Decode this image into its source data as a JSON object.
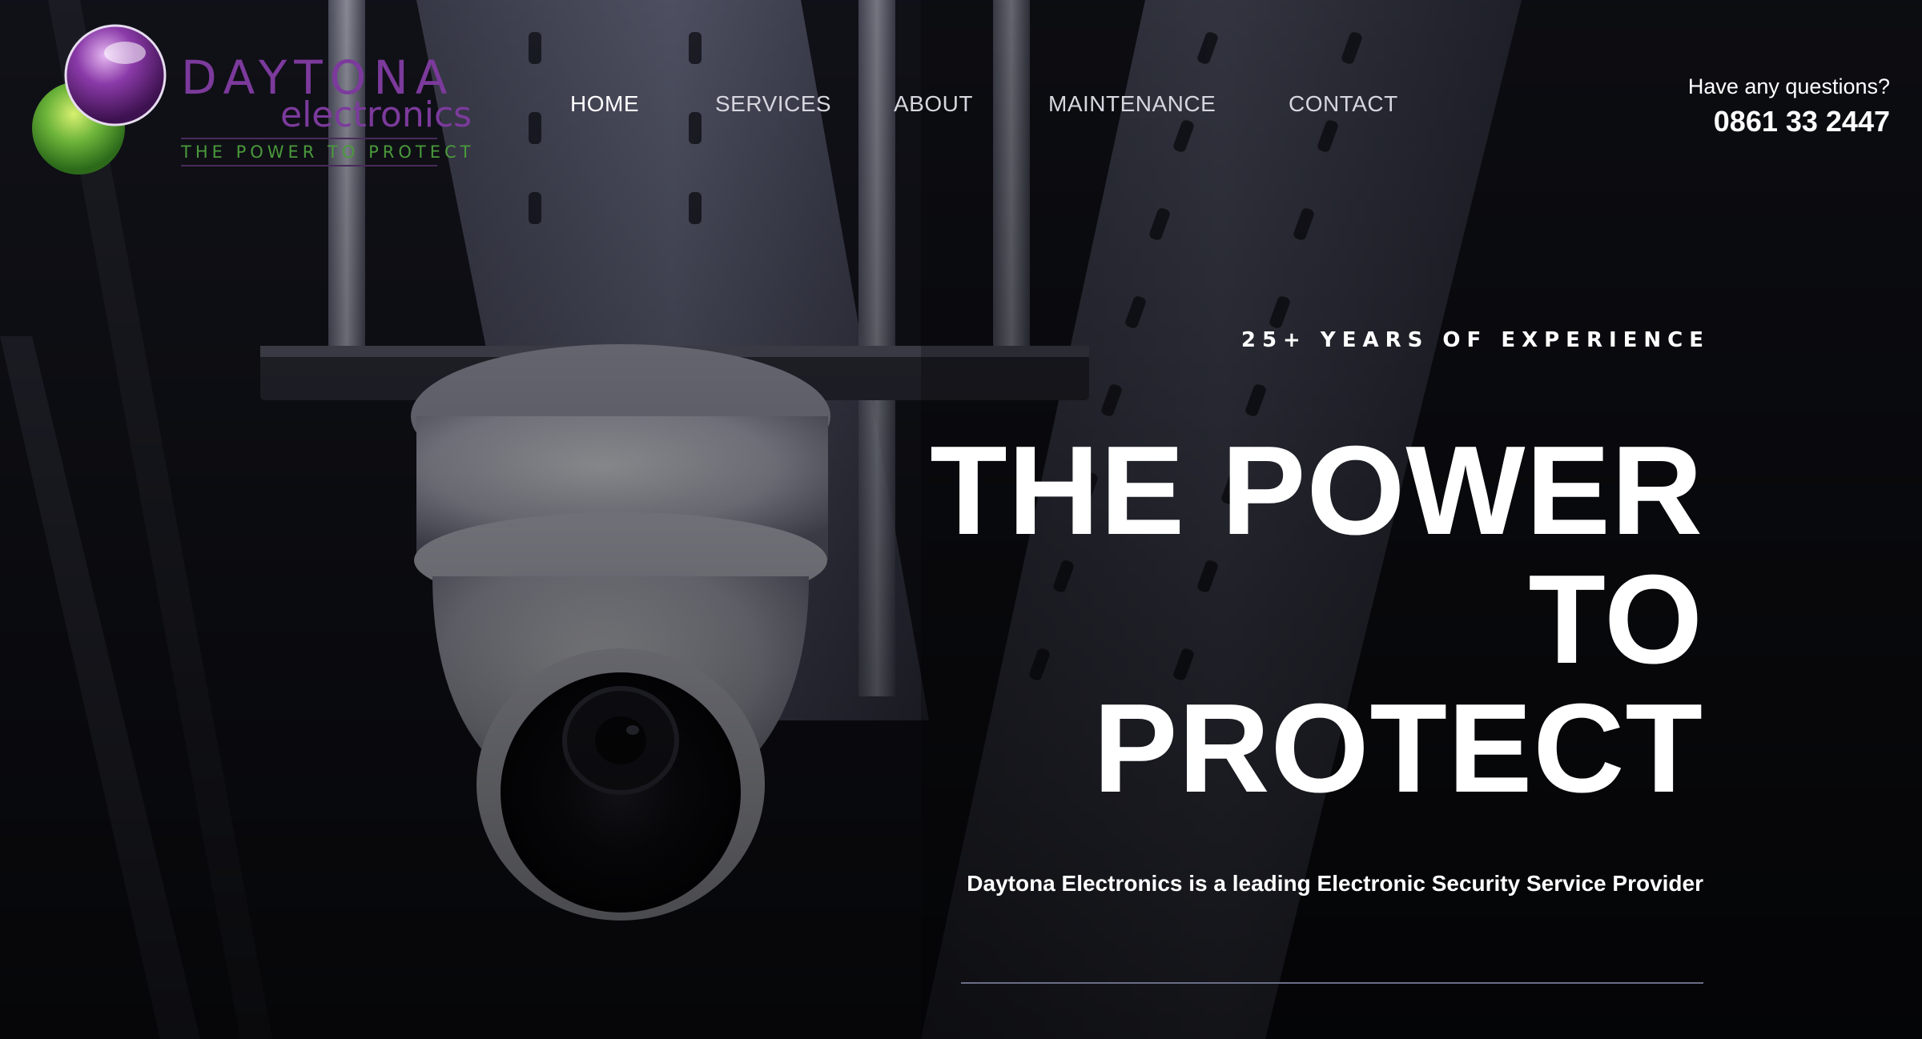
{
  "brand": {
    "name": "DAYTONA",
    "sub": "electronics",
    "tagline": "THE POWER TO PROTECT",
    "colors": {
      "primary": "#7c3a9c",
      "secondary": "#5aa832"
    }
  },
  "nav": {
    "items": [
      {
        "label": "HOME",
        "active": true
      },
      {
        "label": "SERVICES",
        "active": false
      },
      {
        "label": "ABOUT",
        "active": false
      },
      {
        "label": "MAINTENANCE",
        "active": false
      },
      {
        "label": "CONTACT",
        "active": false
      }
    ]
  },
  "contact": {
    "question": "Have any questions?",
    "phone": "0861 33 2447"
  },
  "hero": {
    "eyebrow": "25+ YEARS OF EXPERIENCE",
    "headline": [
      "THE POWER",
      "TO",
      "PROTECT"
    ],
    "lede": "Daytona Electronics is a leading Electronic Security Service Provider",
    "image": "security-camera-photo"
  }
}
